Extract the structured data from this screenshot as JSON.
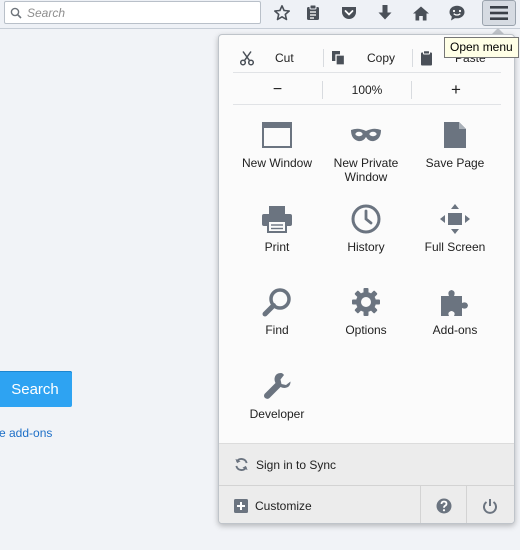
{
  "toolbar": {
    "search_placeholder": "Search",
    "icons": [
      "search-icon",
      "bookmark-star-icon",
      "reading-list-icon",
      "pocket-icon",
      "downloads-icon",
      "home-icon",
      "chat-icon",
      "menu-icon"
    ]
  },
  "tooltip": {
    "text": "Open menu"
  },
  "page": {
    "search_button": "Search",
    "addons_link": "e add-ons"
  },
  "panel": {
    "edit": {
      "cut": "Cut",
      "copy": "Copy",
      "paste": "Paste"
    },
    "zoom": {
      "minus": "−",
      "level": "100%",
      "plus": "+"
    },
    "items": [
      {
        "label": "New Window",
        "icon": "new-window-icon"
      },
      {
        "label": "New Private Window",
        "icon": "private-mask-icon"
      },
      {
        "label": "Save Page",
        "icon": "save-page-icon"
      },
      {
        "label": "Print",
        "icon": "print-icon"
      },
      {
        "label": "History",
        "icon": "history-icon"
      },
      {
        "label": "Full Screen",
        "icon": "full-screen-icon"
      },
      {
        "label": "Find",
        "icon": "find-icon"
      },
      {
        "label": "Options",
        "icon": "options-gear-icon"
      },
      {
        "label": "Add-ons",
        "icon": "addons-puzzle-icon"
      },
      {
        "label": "Developer",
        "icon": "developer-wrench-icon"
      }
    ],
    "sync_label": "Sign in to Sync",
    "customize_label": "Customize"
  },
  "colors": {
    "accent_blue": "#2ea3f2",
    "link_blue": "#1e6fc7",
    "icon_gray": "#6b7480"
  }
}
